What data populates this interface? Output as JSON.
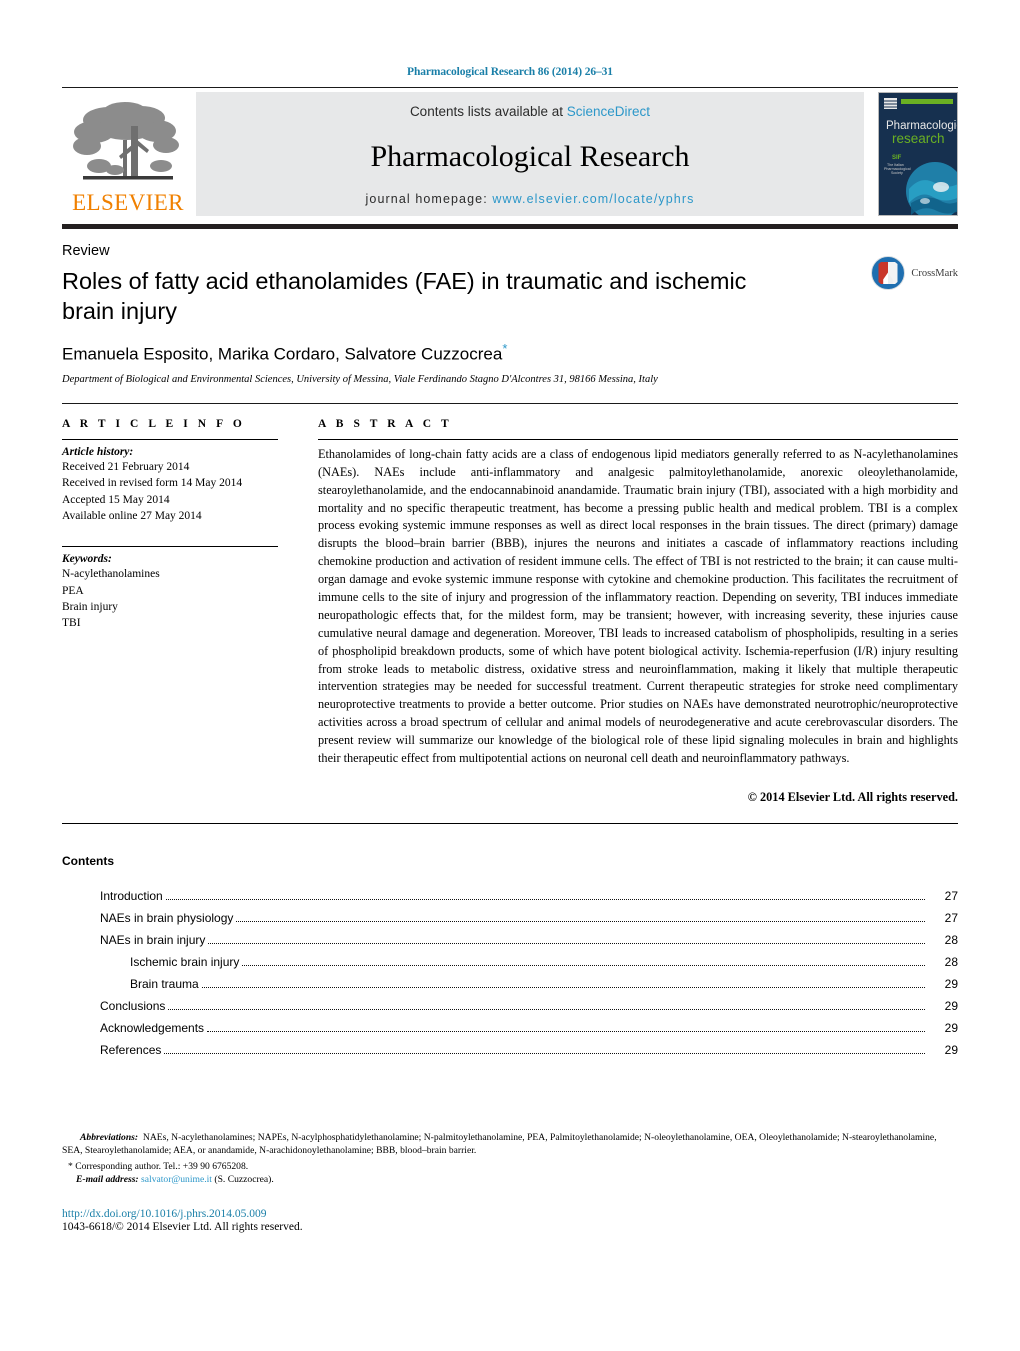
{
  "running_head": "Pharmacological Research 86 (2014) 26–31",
  "masthead": {
    "publisher_logo_text": "ELSEVIER",
    "contents_prefix": "Contents lists available at ",
    "contents_link": "ScienceDirect",
    "journal_title": "Pharmacological Research",
    "homepage_prefix": "journal homepage: ",
    "homepage_url": "www.elsevier.com/locate/yphrs",
    "cover": {
      "line1": "Pharmacological",
      "line2": "research",
      "society_line1": "The Italian",
      "society_line2": "Pharmacological",
      "society_line3": "Society"
    }
  },
  "title_block": {
    "article_type": "Review",
    "title": "Roles of fatty acid ethanolamides (FAE) in traumatic and ischemic brain injury",
    "authors": "Emanuela Esposito, Marika Cordaro, Salvatore Cuzzocrea",
    "corresponding_marker": "*",
    "affiliation": "Department of Biological and Environmental Sciences, University of Messina, Viale Ferdinando Stagno D'Alcontres 31, 98166 Messina, Italy",
    "crossmark_label": "CrossMark"
  },
  "article_info": {
    "heading": "A R T I C L E   I N F O",
    "history_label": "Article history:",
    "history": [
      "Received 21 February 2014",
      "Received in revised form 14 May 2014",
      "Accepted 15 May 2014",
      "Available online 27 May 2014"
    ],
    "keywords_label": "Keywords:",
    "keywords": [
      "N-acylethanolamines",
      "PEA",
      "Brain injury",
      "TBI"
    ]
  },
  "abstract": {
    "heading": "A B S T R A C T",
    "text": "Ethanolamides of long-chain fatty acids are a class of endogenous lipid mediators generally referred to as N-acylethanolamines (NAEs). NAEs include anti-inflammatory and analgesic palmitoylethanolamide, anorexic oleoylethanolamide, stearoylethanolamide, and the endocannabinoid anandamide. Traumatic brain injury (TBI), associated with a high morbidity and mortality and no specific therapeutic treatment, has become a pressing public health and medical problem. TBI is a complex process evoking systemic immune responses as well as direct local responses in the brain tissues. The direct (primary) damage disrupts the blood–brain barrier (BBB), injures the neurons and initiates a cascade of inflammatory reactions including chemokine production and activation of resident immune cells. The effect of TBI is not restricted to the brain; it can cause multi-organ damage and evoke systemic immune response with cytokine and chemokine production. This facilitates the recruitment of immune cells to the site of injury and progression of the inflammatory reaction. Depending on severity, TBI induces immediate neuropathologic effects that, for the mildest form, may be transient; however, with increasing severity, these injuries cause cumulative neural damage and degeneration. Moreover, TBI leads to increased catabolism of phospholipids, resulting in a series of phospholipid breakdown products, some of which have potent biological activity. Ischemia-reperfusion (I/R) injury resulting from stroke leads to metabolic distress, oxidative stress and neuroinflammation, making it likely that multiple therapeutic intervention strategies may be needed for successful treatment. Current therapeutic strategies for stroke need complimentary neuroprotective treatments to provide a better outcome. Prior studies on NAEs have demonstrated neurotrophic/neuroprotective activities across a broad spectrum of cellular and animal models of neurodegenerative and acute cerebrovascular disorders. The present review will summarize our knowledge of the biological role of these lipid signaling molecules in brain and highlights their therapeutic effect from multipotential actions on neuronal cell death and neuroinflammatory pathways.",
    "copyright": "© 2014 Elsevier Ltd. All rights reserved."
  },
  "contents": {
    "heading": "Contents",
    "items": [
      {
        "label": "Introduction",
        "page": "27",
        "indent": false
      },
      {
        "label": "NAEs in brain physiology",
        "page": "27",
        "indent": false
      },
      {
        "label": "NAEs in brain injury",
        "page": "28",
        "indent": false
      },
      {
        "label": "Ischemic brain injury",
        "page": "28",
        "indent": true
      },
      {
        "label": "Brain trauma",
        "page": "29",
        "indent": true
      },
      {
        "label": "Conclusions",
        "page": "29",
        "indent": false
      },
      {
        "label": "Acknowledgements",
        "page": "29",
        "indent": false
      },
      {
        "label": "References",
        "page": "29",
        "indent": false
      }
    ]
  },
  "footnotes": {
    "abbreviations_label": "Abbreviations:",
    "abbreviations_text": "NAEs, N-acylethanolamines; NAPEs, N-acylphosphatidylethanolamine; N-palmitoylethanolamine, PEA, Palmitoylethanolamide; N-oleoylethanolamine, OEA, Oleoylethanolamide; N-stearoylethanolamine, SEA, Stearoylethanolamide; AEA, or anandamide, N-arachidonoylethanolamine; BBB, blood–brain barrier.",
    "corresponding_marker": "*",
    "corresponding_text": "Corresponding author. Tel.: +39 90 6765208.",
    "email_label": "E-mail address:",
    "email": "salvator@unime.it",
    "email_suffix": "(S. Cuzzocrea).",
    "doi": "http://dx.doi.org/10.1016/j.phrs.2014.05.009",
    "issn_line": "1043-6618/© 2014 Elsevier Ltd. All rights reserved."
  },
  "colors": {
    "link": "#2c97c9",
    "running_head": "#1a7fa8",
    "elsevier_orange": "#f08000",
    "masthead_bg": "#e7e8e9",
    "cover_navy": "#16304f",
    "cover_green": "#6ab023"
  }
}
